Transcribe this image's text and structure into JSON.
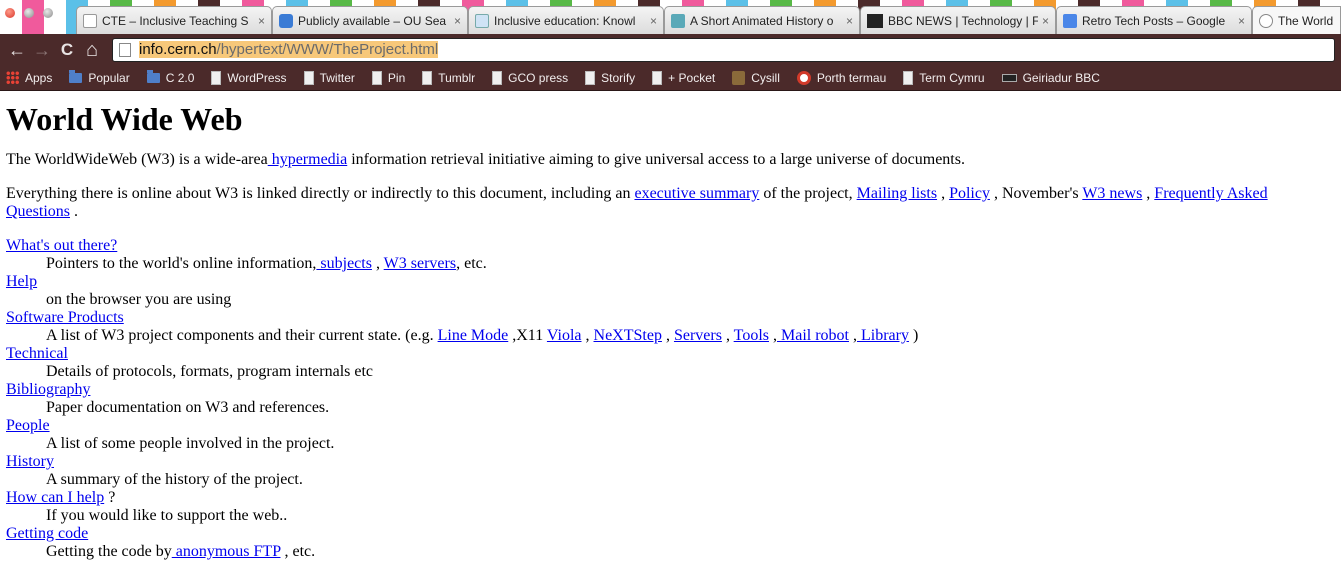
{
  "browser": {
    "tabs": [
      {
        "title": "CTE – Inclusive Teaching S",
        "favicon": "page-icon",
        "close": "×"
      },
      {
        "title": "Publicly available – OU Sea",
        "favicon": "shield-icon",
        "close": "×"
      },
      {
        "title": "Inclusive education: Knowl",
        "favicon": "ou-icon",
        "close": "×"
      },
      {
        "title": "A Short Animated History o",
        "favicon": "video-icon",
        "close": "×"
      },
      {
        "title": "BBC NEWS | Technology | F",
        "favicon": "bbc-icon",
        "close": "×"
      },
      {
        "title": "Retro Tech Posts – Google",
        "favicon": "docs-icon",
        "close": "×"
      },
      {
        "title": "The World W",
        "favicon": "globe-icon",
        "close": ""
      }
    ],
    "nav": {
      "back": "←",
      "forward": "→",
      "reload": "C",
      "home": "⌂"
    },
    "url": {
      "host": "info.cern.ch",
      "path": "/hypertext/WWW/TheProject.html"
    },
    "bookmarks": [
      {
        "label": "Apps",
        "icon": "apps-icon"
      },
      {
        "label": "Popular",
        "icon": "folder-icon"
      },
      {
        "label": "C 2.0",
        "icon": "folder-icon"
      },
      {
        "label": "WordPress",
        "icon": "page-icon"
      },
      {
        "label": "Twitter",
        "icon": "page-icon"
      },
      {
        "label": "Pin",
        "icon": "page-icon"
      },
      {
        "label": "Tumblr",
        "icon": "page-icon"
      },
      {
        "label": "GCO press",
        "icon": "page-icon"
      },
      {
        "label": "Storify",
        "icon": "page-icon"
      },
      {
        "label": "+ Pocket",
        "icon": "page-icon"
      },
      {
        "label": "Cysill",
        "icon": "cysill-icon"
      },
      {
        "label": "Porth termau",
        "icon": "porth-icon"
      },
      {
        "label": "Term Cymru",
        "icon": "page-icon"
      },
      {
        "label": "Geiriadur BBC",
        "icon": "bbc-icon"
      }
    ]
  },
  "page": {
    "title": "World Wide Web",
    "intro": {
      "before": "The WorldWideWeb (W3) is a wide-area",
      "link": " hypermedia",
      "after": " information retrieval initiative aiming to give universal access to a large universe of documents."
    },
    "everything": {
      "before": "Everything there is online about W3 is linked directly or indirectly to this document, including an ",
      "link_exec": "executive summary",
      "mid1": " of the project, ",
      "link_mailing": "Mailing lists",
      "mid2": " , ",
      "link_policy": "Policy",
      "mid3": " , November's ",
      "link_news": "W3 news",
      "mid4": " , ",
      "link_faq": "Frequently Asked Questions",
      "end": " ."
    },
    "entries": {
      "whats_out": {
        "term": "What's out there?",
        "desc_before": "Pointers to the world's online information,",
        "link1": " subjects",
        "mid": " , ",
        "link2": "W3 servers",
        "end": ", etc."
      },
      "help": {
        "term": "Help",
        "desc": "on the browser you are using"
      },
      "software": {
        "term": "Software Products",
        "desc_before": "A list of W3 project components and their current state. (e.g. ",
        "l1": "Line Mode",
        "t1": " ,X11 ",
        "l2": "Viola",
        "t2": " , ",
        "l3": "NeXTStep",
        "t3": " , ",
        "l4": "Servers",
        "t4": " , ",
        "l5": "Tools",
        "t5": " ,",
        "l6": " Mail robot",
        "t6": " ,",
        "l7": " Library",
        "end": " )"
      },
      "technical": {
        "term": "Technical",
        "desc": "Details of protocols, formats, program internals etc"
      },
      "bibliography": {
        "term": "Bibliography",
        "desc": "Paper documentation on W3 and references."
      },
      "people": {
        "term": "People",
        "desc": "A list of some people involved in the project."
      },
      "history": {
        "term": "History",
        "desc": "A summary of the history of the project."
      },
      "howhelp": {
        "term": "How can I help",
        "term_after": " ?",
        "desc": "If you would like to support the web.."
      },
      "getting_code": {
        "term": "Getting code",
        "desc_before": "Getting the code by",
        "link": " anonymous FTP",
        "end": " , etc."
      }
    }
  }
}
